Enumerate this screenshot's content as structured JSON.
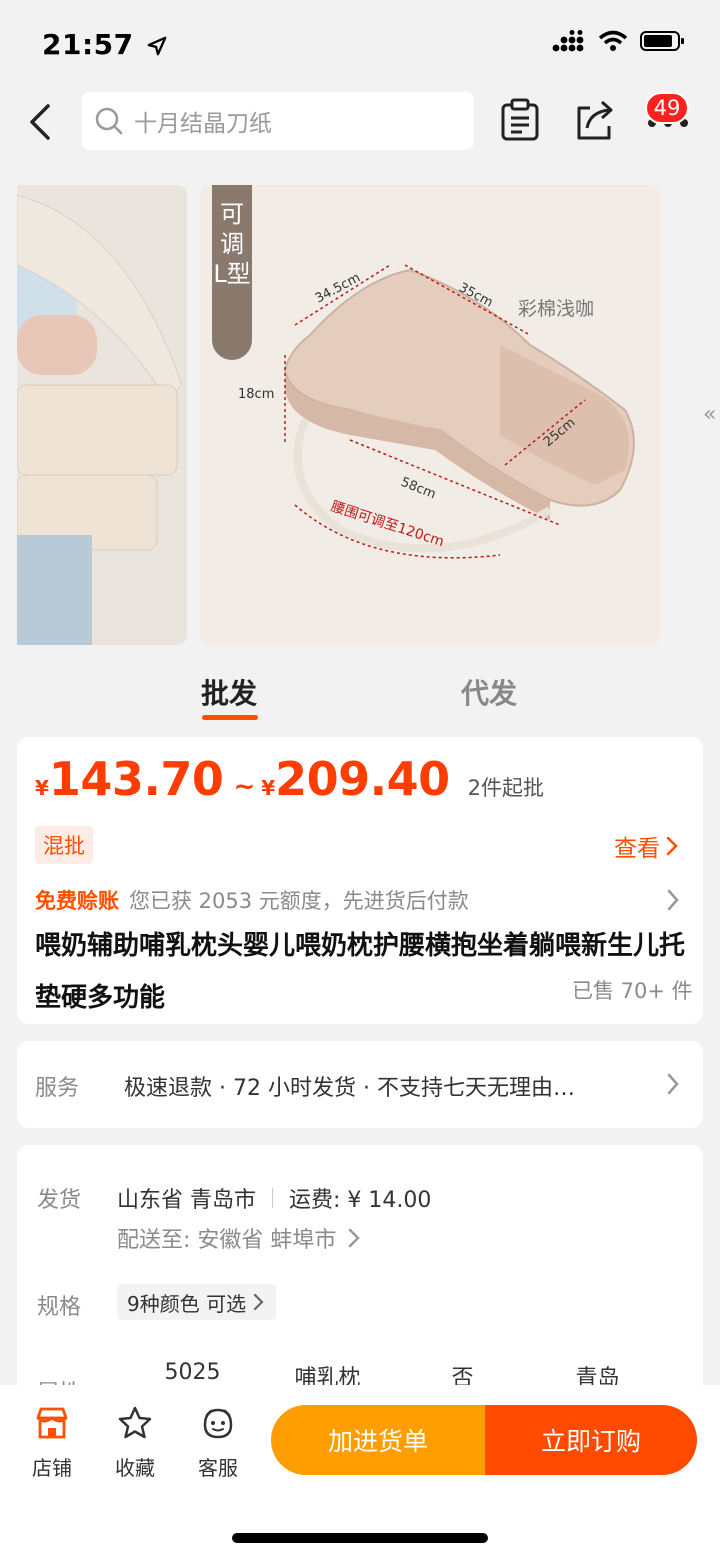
{
  "status_bar": {
    "time": "21:57"
  },
  "header": {
    "search_placeholder": "十月结晶刀纸",
    "cart_badge": "49"
  },
  "gallery": {
    "tag_text": "可调\nL型",
    "diagram_labels": {
      "top_left": "34.5cm",
      "top_right": "35cm",
      "height": "18cm",
      "length": "58cm",
      "depth": "25cm",
      "waist": "腰围可调至120cm",
      "color": "彩棉浅咖"
    }
  },
  "tabs": [
    {
      "label": "批发",
      "active": true
    },
    {
      "label": "代发",
      "active": false
    }
  ],
  "price": {
    "currency": "¥",
    "low": "143.70",
    "sep": "~",
    "high": "209.40",
    "min_order": "2件起批"
  },
  "mix_badge": "混批",
  "view_link": "查看",
  "credit": {
    "label": "免费赊账",
    "text": "您已获 2053 元额度，先进货后付款"
  },
  "product": {
    "title": "喂奶辅助哺乳枕头婴儿喂奶枕护腰横抱坐着躺喂新生儿托垫硬多功能",
    "sold": "已售 70+ 件"
  },
  "service": {
    "label": "服务",
    "text": "极速退款 · 72 小时发货 · 不支持七天无理由…"
  },
  "shipping": {
    "label": "发货",
    "origin": "山东省 青岛市",
    "fee": "运费: ¥ 14.00",
    "dest": "配送至: 安徽省 蚌埠市"
  },
  "spec": {
    "label": "规格",
    "value": "9种颜色 可选"
  },
  "attrs": {
    "label": "属性",
    "values": [
      "5025",
      "哺乳枕",
      "否",
      "青岛"
    ]
  },
  "bottom_nav": [
    {
      "label": "店铺",
      "icon": "shop-icon"
    },
    {
      "label": "收藏",
      "icon": "star-icon"
    },
    {
      "label": "客服",
      "icon": "service-face-icon"
    }
  ],
  "buttons": {
    "add_cart": "加进货单",
    "buy_now": "立即订购"
  },
  "colors": {
    "accent": "#ff5000",
    "price": "#ff3d00",
    "cart_btn": "#ff9e00",
    "buy_btn": "#ff4a00"
  }
}
